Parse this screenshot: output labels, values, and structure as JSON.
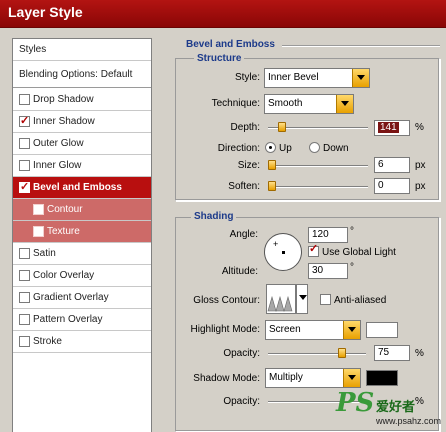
{
  "window": {
    "title": "Layer Style"
  },
  "left_panel": {
    "header": "Styles",
    "blending": "Blending Options: Default",
    "items": [
      {
        "label": "Drop Shadow",
        "checked": false
      },
      {
        "label": "Inner Shadow",
        "checked": true
      },
      {
        "label": "Outer Glow",
        "checked": false
      },
      {
        "label": "Inner Glow",
        "checked": false
      },
      {
        "label": "Bevel and Emboss",
        "checked": true,
        "active": true
      },
      {
        "label": "Contour",
        "checked": false,
        "sub": true
      },
      {
        "label": "Texture",
        "checked": false,
        "sub": true
      },
      {
        "label": "Satin",
        "checked": false
      },
      {
        "label": "Color Overlay",
        "checked": false
      },
      {
        "label": "Gradient Overlay",
        "checked": false
      },
      {
        "label": "Pattern Overlay",
        "checked": false
      },
      {
        "label": "Stroke",
        "checked": false
      }
    ]
  },
  "bevel": {
    "title": "Bevel and Emboss",
    "structure_title": "Structure",
    "style_label": "Style:",
    "style_value": "Inner Bevel",
    "technique_label": "Technique:",
    "technique_value": "Smooth",
    "depth_label": "Depth:",
    "depth_value": "141",
    "depth_unit": "%",
    "direction_label": "Direction:",
    "direction_up": "Up",
    "direction_down": "Down",
    "size_label": "Size:",
    "size_value": "6",
    "size_unit": "px",
    "soften_label": "Soften:",
    "soften_value": "0",
    "soften_unit": "px"
  },
  "shading": {
    "title": "Shading",
    "angle_label": "Angle:",
    "angle_value": "120",
    "angle_unit": "°",
    "global_light_label": "Use Global Light",
    "altitude_label": "Altitude:",
    "altitude_value": "30",
    "altitude_unit": "°",
    "gloss_label": "Gloss Contour:",
    "anti_aliased_label": "Anti-aliased",
    "highlight_label": "Highlight Mode:",
    "highlight_value": "Screen",
    "highlight_color": "#ffffff",
    "highlight_opacity_label": "Opacity:",
    "highlight_opacity_value": "75",
    "highlight_opacity_unit": "%",
    "shadow_label": "Shadow Mode:",
    "shadow_value": "Multiply",
    "shadow_color": "#000000",
    "shadow_opacity_label": "Opacity:",
    "shadow_opacity_unit": "%"
  },
  "watermark": {
    "logo": "PS",
    "text": "爱好者",
    "url": "www.psahz.com"
  }
}
